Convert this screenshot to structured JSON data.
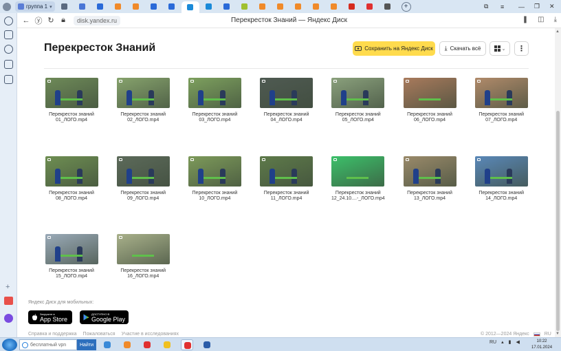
{
  "browser": {
    "tab_group_label": "группа 1",
    "window_title": "Перекресток Знаний — Яндекс Диск",
    "url": "disk.yandex.ru",
    "tab_icon_colors": [
      "#5b6a80",
      "#4a76d6",
      "#2a6ad8",
      "#f08a2a",
      "#f08a2a",
      "#2a6ad8",
      "#2a6ad8",
      "#1a8ad8",
      "#1a8ad8",
      "#2a6ad8",
      "#a0c030",
      "#f08a2a",
      "#f08a2a",
      "#f08a2a",
      "#f08a2a",
      "#f08a2a",
      "#d52b1e",
      "#e03030",
      "#555555"
    ]
  },
  "header": {
    "title": "Перекресток Знаний",
    "save_label": "Сохранить на Яндекс Диск",
    "download_label": "Скачать всё"
  },
  "files": [
    {
      "line1": "Перекресток знаний",
      "line2": "01_ЛОГО.mp4",
      "bg": "#6e8a58",
      "fig": true
    },
    {
      "line1": "Перекресток знаний",
      "line2": "02_ЛОГО.mp4",
      "bg": "#86a26c",
      "fig": true
    },
    {
      "line1": "Перекресток знаний",
      "line2": "03_ЛОГО.mp4",
      "bg": "#7da05e",
      "fig": true
    },
    {
      "line1": "Перекресток знаний",
      "line2": "04_ЛОГО.mp4",
      "bg": "#4f5a52",
      "fig": true
    },
    {
      "line1": "Перекресток знаний",
      "line2": "05_ЛОГО.mp4",
      "bg": "#8aa07c",
      "fig": true
    },
    {
      "line1": "Перекресток знаний",
      "line2": "06_ЛОГО.mp4",
      "bg": "#a87a5c",
      "fig": false
    },
    {
      "line1": "Перекресток знаний",
      "line2": "07_ЛОГО.mp4",
      "bg": "#b08a6a",
      "fig": true
    },
    {
      "line1": "Перекресток знаний",
      "line2": "08_ЛОГО.mp4",
      "bg": "#6e8e52",
      "fig": true
    },
    {
      "line1": "Перекресток знаний",
      "line2": "09_ЛОГО.mp4",
      "bg": "#5c6a5a",
      "fig": true
    },
    {
      "line1": "Перекресток знаний",
      "line2": "10_ЛОГО.mp4",
      "bg": "#7d9a5a",
      "fig": true
    },
    {
      "line1": "Перекресток знаний",
      "line2": "11_ЛОГО.mp4",
      "bg": "#5e7a4a",
      "fig": true
    },
    {
      "line1": "Перекресток знаний",
      "line2": "12_24.10....-_ЛОГО.mp4",
      "bg": "#3cc06a",
      "fig": false
    },
    {
      "line1": "Перекресток знаний",
      "line2": "13_ЛОГО.mp4",
      "bg": "#9a8a6a",
      "fig": true
    },
    {
      "line1": "Перекресток знаний",
      "line2": "14_ЛОГО.mp4",
      "bg": "#5a88b8",
      "fig": true
    },
    {
      "line1": "Перекресток знаний",
      "line2": "15_ЛОГО.mp4",
      "bg": "#9aaab8",
      "fig": true
    },
    {
      "line1": "Перекресток знаний",
      "line2": "16_ЛОГО.mp4",
      "bg": "#a8b08a",
      "fig": false
    }
  ],
  "footer": {
    "mobile_caption": "Яндекс Диск для мобильных:",
    "appstore_small": "Загрузите в",
    "appstore_big": "App Store",
    "gplay_small": "ДОСТУПНО В",
    "gplay_big": "Google Play",
    "links": [
      "Справка и поддержка",
      "Пожаловаться",
      "Участие в исследованиях"
    ],
    "copyright": "© 2012—2024 Яндекс",
    "lang": "RU"
  },
  "taskbar": {
    "search_text": "бесплатный vpn",
    "find_label": "Найти",
    "lang": "RU",
    "time": "10:22",
    "date": "17.01.2024",
    "app_colors": [
      "#3a8ad8",
      "#f08a2a",
      "#e03030",
      "#f0c020",
      "#e03030",
      "#2b5ca8"
    ]
  }
}
